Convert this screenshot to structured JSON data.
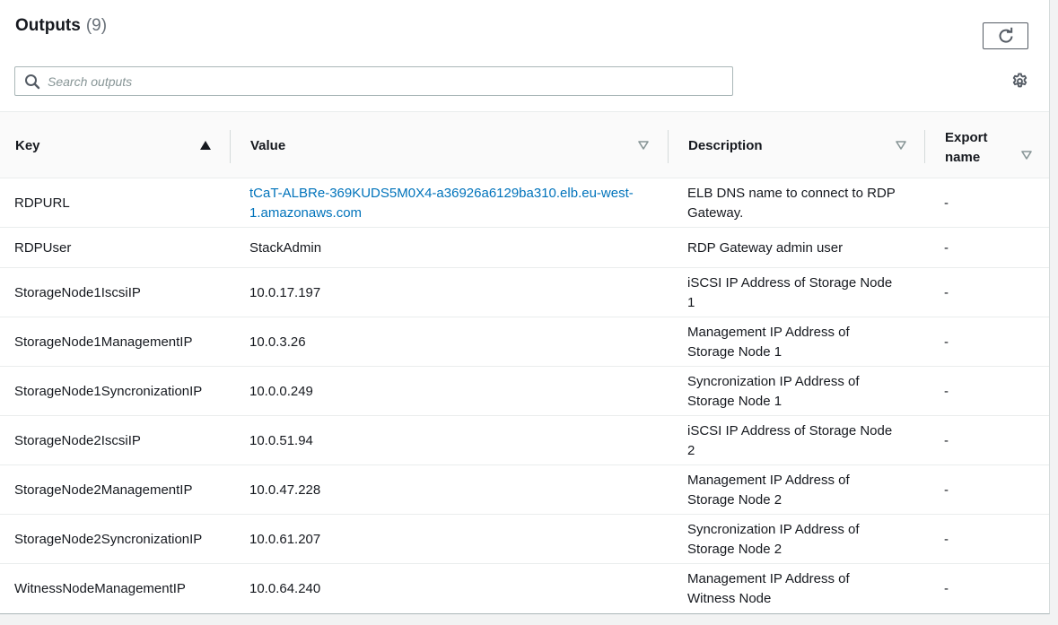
{
  "header": {
    "title": "Outputs",
    "count": "(9)",
    "refresh_icon": "refresh-icon",
    "settings_icon": "gear-icon"
  },
  "search": {
    "placeholder": "Search outputs",
    "value": "",
    "icon": "search-icon"
  },
  "columns": [
    {
      "label": "Key",
      "sort": "ascending",
      "sort_icon": "caret-up-icon"
    },
    {
      "label": "Value",
      "sort": "none",
      "sort_icon": "caret-down-icon"
    },
    {
      "label": "Description",
      "sort": "none",
      "sort_icon": "caret-down-icon"
    },
    {
      "label": "Export\nname",
      "sort": "none",
      "sort_icon": "caret-down-icon"
    }
  ],
  "rows": [
    {
      "key": "RDPURL",
      "value": "tCaT-ALBRe-369KUDS5M0X4-a36926a6129ba310.elb.eu-west-1.amazonaws.com",
      "value_line1": "tCaT-ALBRe-369KUDS5M0X4-a36926a6129ba310.elb.eu-west-",
      "value_line2": "1.amazonaws.com",
      "description_line1": "ELB DNS name to connect to RDP",
      "description_line2": "Gateway.",
      "export": "-"
    },
    {
      "key": "RDPUser",
      "value": "StackAdmin",
      "description_line1": "RDP Gateway admin user",
      "description_line2": "",
      "export": "-"
    },
    {
      "key": "StorageNode1IscsiIP",
      "value": "10.0.17.197",
      "description_line1": "iSCSI IP Address of Storage Node",
      "description_line2": "1",
      "export": "-"
    },
    {
      "key": "StorageNode1ManagementIP",
      "value": "10.0.3.26",
      "description_line1": "Management IP Address of",
      "description_line2": "Storage Node 1",
      "export": "-"
    },
    {
      "key": "StorageNode1SyncronizationIP",
      "value": "10.0.0.249",
      "description_line1": "Syncronization IP Address of",
      "description_line2": "Storage Node 1",
      "export": "-"
    },
    {
      "key": "StorageNode2IscsiIP",
      "value": "10.0.51.94",
      "description_line1": "iSCSI IP Address of Storage Node",
      "description_line2": "2",
      "export": "-"
    },
    {
      "key": "StorageNode2ManagementIP",
      "value": "10.0.47.228",
      "description_line1": "Management IP Address of",
      "description_line2": "Storage Node 2",
      "export": "-"
    },
    {
      "key": "StorageNode2SyncronizationIP",
      "value": "10.0.61.207",
      "description_line1": "Syncronization IP Address of",
      "description_line2": "Storage Node 2",
      "export": "-"
    },
    {
      "key": "WitnessNodeManagementIP",
      "value": "10.0.64.240",
      "description_line1": "Management IP Address of",
      "description_line2": "Witness Node",
      "export": "-"
    }
  ],
  "colors": {
    "link": "#0073bb",
    "text": "#16191f",
    "muted": "#687078",
    "sort_icon": "#879596",
    "border": "#eaeded"
  }
}
